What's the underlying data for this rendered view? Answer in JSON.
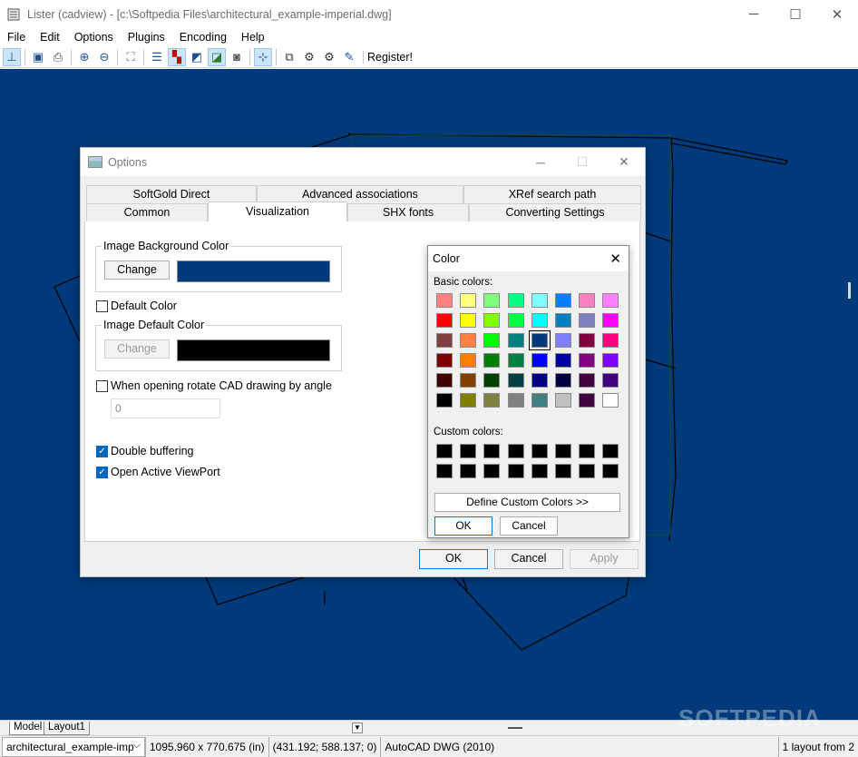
{
  "window": {
    "title": "Lister (cadview) - [c:\\Softpedia Files\\architectural_example-imperial.dwg]",
    "minimize": "─",
    "maximize": "☐",
    "close": "✕"
  },
  "menu": [
    "File",
    "Edit",
    "Options",
    "Plugins",
    "Encoding",
    "Help"
  ],
  "toolbar": {
    "register_label": "Register!"
  },
  "tabs_bottom": {
    "model": "Model",
    "layout1": "Layout1"
  },
  "status": {
    "file": "architectural_example-imp",
    "size": "1095.960 x 770.675 (in)",
    "coords": "(431.192; 588.137; 0)",
    "format": "AutoCAD DWG (2010)",
    "layouts": "1 layout from 2"
  },
  "options_dialog": {
    "title": "Options",
    "tabs_row1": [
      "SoftGold Direct",
      "Advanced associations",
      "XRef search path"
    ],
    "tabs_row2": [
      "Common",
      "Visualization",
      "SHX fonts",
      "Converting Settings"
    ],
    "selected_tab": "Visualization",
    "bg_group_label": "Image Background Color",
    "bg_change": "Change",
    "bg_color": "#003a7a",
    "default_color_label": "Default Color",
    "default_group_label": "Image Default Color",
    "default_change": "Change",
    "default_color": "#000000",
    "rotate_label": "When opening rotate CAD drawing by angle",
    "rotate_value": "0",
    "double_buffering": "Double buffering",
    "open_viewport": "Open Active ViewPort",
    "ok": "OK",
    "cancel": "Cancel",
    "apply": "Apply"
  },
  "color_dialog": {
    "title": "Color",
    "close": "✕",
    "basic_label": "Basic colors:",
    "custom_label": "Custom colors:",
    "define_custom": "Define Custom Colors >>",
    "ok": "OK",
    "cancel": "Cancel",
    "selected": "#003a7a",
    "basic_colors": [
      "#ff8080",
      "#ffff80",
      "#80ff80",
      "#00ff80",
      "#80ffff",
      "#0080ff",
      "#ff80c0",
      "#ff80ff",
      "#ff0000",
      "#ffff00",
      "#80ff00",
      "#00ff40",
      "#00ffff",
      "#0080c0",
      "#8080c0",
      "#ff00ff",
      "#804040",
      "#ff8040",
      "#00ff00",
      "#008080",
      "#003a7a",
      "#8080ff",
      "#800040",
      "#ff0080",
      "#800000",
      "#ff8000",
      "#008000",
      "#008040",
      "#0000ff",
      "#0000a0",
      "#800080",
      "#8000ff",
      "#400000",
      "#804000",
      "#004000",
      "#004040",
      "#000080",
      "#000040",
      "#400040",
      "#400080",
      "#000000",
      "#808000",
      "#808040",
      "#808080",
      "#408080",
      "#c0c0c0",
      "#400040",
      "#ffffff"
    ],
    "custom_colors": [
      "#000000",
      "#000000",
      "#000000",
      "#000000",
      "#000000",
      "#000000",
      "#000000",
      "#000000",
      "#000000",
      "#000000",
      "#000000",
      "#000000",
      "#000000",
      "#000000",
      "#000000",
      "#000000"
    ]
  },
  "watermark": "SOFTPEDIA"
}
